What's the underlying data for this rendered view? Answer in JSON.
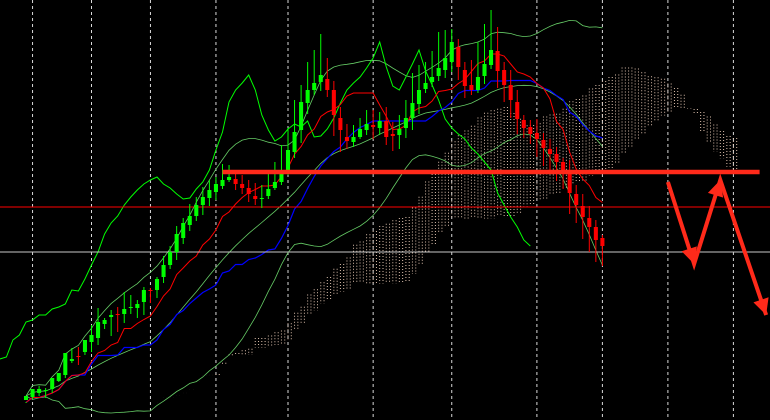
{
  "colors": {
    "background": "#000000",
    "grid": "#ffffff",
    "bull_candle": "#00ff00",
    "bear_candle": "#ff0000",
    "tenkan": "#ff0000",
    "kijun": "#0000ff",
    "chikou": "#00ff00",
    "bollinger": "#66cc66",
    "cloud_dots": "#f5d5c0",
    "hline_upper": "#ff0000",
    "hline_lower": "#c8c8c8",
    "annotation": "#ff2a1a"
  },
  "chart_data": {
    "type": "candlestick",
    "grid": true,
    "ylim": [
      0,
      420
    ],
    "vertical_grid_at_bar": [
      1,
      10,
      19,
      29,
      40,
      53,
      65,
      78,
      88,
      98,
      108,
      117
    ],
    "horizontal_levels": [
      {
        "name": "upper-level",
        "value": 213
      },
      {
        "name": "lower-level",
        "value": 168
      }
    ],
    "annotation": {
      "resistance_line": {
        "from_bar": 30,
        "to_bar": 112,
        "value": 248
      },
      "projected_path": [
        {
          "bar": 98,
          "value": 238
        },
        {
          "bar": 102,
          "value": 156
        },
        {
          "bar": 106,
          "value": 240
        },
        {
          "bar": 113,
          "value": 105
        }
      ]
    },
    "ohlc": [
      [
        20,
        24,
        18,
        17
      ],
      [
        23,
        31,
        28,
        21
      ],
      [
        27,
        31,
        24,
        34
      ],
      [
        29,
        30,
        32,
        22
      ],
      [
        31,
        42,
        37,
        27
      ],
      [
        39,
        47,
        44,
        38
      ],
      [
        45,
        67,
        60,
        42
      ],
      [
        59,
        61,
        72,
        57
      ],
      [
        64,
        63,
        73,
        55
      ],
      [
        68,
        80,
        71,
        65
      ],
      [
        78,
        85,
        95,
        68
      ],
      [
        82,
        98,
        112,
        75
      ],
      [
        96,
        100,
        102,
        91
      ],
      [
        103,
        105,
        110,
        84
      ],
      [
        106,
        105,
        113,
        88
      ],
      [
        106,
        111,
        128,
        97
      ],
      [
        112,
        113,
        125,
        106
      ],
      [
        112,
        116,
        120,
        102
      ],
      [
        118,
        130,
        133,
        105
      ],
      [
        130,
        129,
        132,
        117
      ],
      [
        130,
        141,
        143,
        122
      ],
      [
        143,
        155,
        164,
        137
      ],
      [
        155,
        168,
        174,
        151
      ],
      [
        168,
        186,
        194,
        160
      ],
      [
        182,
        197,
        202,
        176
      ],
      [
        195,
        204,
        216,
        189
      ],
      [
        204,
        215,
        223,
        199
      ],
      [
        215,
        223,
        233,
        205
      ],
      [
        222,
        230,
        240,
        214
      ],
      [
        228,
        236,
        243,
        220
      ],
      [
        234,
        240,
        256,
        231
      ],
      [
        240,
        243,
        255,
        238
      ],
      [
        241,
        236,
        250,
        230
      ],
      [
        236,
        232,
        245,
        226
      ],
      [
        232,
        226,
        240,
        218
      ],
      [
        224,
        221,
        237,
        215
      ],
      [
        221,
        222,
        235,
        212
      ],
      [
        224,
        231,
        248,
        221
      ],
      [
        232,
        238,
        258,
        230
      ],
      [
        238,
        250,
        275,
        235
      ],
      [
        249,
        270,
        292,
        245
      ],
      [
        268,
        288,
        320,
        262
      ],
      [
        290,
        318,
        335,
        277
      ],
      [
        317,
        330,
        358,
        306
      ],
      [
        330,
        337,
        370,
        325
      ],
      [
        338,
        345,
        386,
        329
      ],
      [
        341,
        330,
        362,
        323
      ],
      [
        330,
        305,
        339,
        284
      ],
      [
        302,
        290,
        313,
        268
      ],
      [
        283,
        279,
        296,
        271
      ],
      [
        278,
        283,
        295,
        273
      ],
      [
        283,
        291,
        302,
        281
      ],
      [
        290,
        296,
        310,
        285
      ],
      [
        295,
        293,
        310,
        281
      ],
      [
        292,
        299,
        308,
        285
      ],
      [
        299,
        283,
        313,
        275
      ],
      [
        286,
        284,
        298,
        269
      ],
      [
        285,
        291,
        305,
        271
      ],
      [
        292,
        302,
        320,
        282
      ],
      [
        302,
        317,
        347,
        290
      ],
      [
        316,
        330,
        355,
        306
      ],
      [
        331,
        337,
        358,
        327
      ],
      [
        338,
        343,
        369,
        333
      ],
      [
        344,
        352,
        388,
        339
      ],
      [
        350,
        362,
        390,
        342
      ],
      [
        358,
        378,
        391,
        348
      ],
      [
        373,
        353,
        381,
        340
      ],
      [
        350,
        334,
        358,
        322
      ],
      [
        335,
        330,
        360,
        325
      ],
      [
        330,
        343,
        378,
        327
      ],
      [
        344,
        356,
        396,
        336
      ],
      [
        355,
        370,
        410,
        351
      ],
      [
        369,
        349,
        393,
        332
      ],
      [
        350,
        335,
        358,
        318
      ],
      [
        335,
        320,
        350,
        302
      ],
      [
        318,
        301,
        330,
        286
      ],
      [
        300,
        292,
        305,
        282
      ],
      [
        293,
        286,
        300,
        276
      ],
      [
        287,
        281,
        301,
        263
      ],
      [
        280,
        272,
        287,
        254
      ],
      [
        271,
        266,
        281,
        249
      ],
      [
        266,
        258,
        273,
        239
      ],
      [
        258,
        250,
        262,
        231
      ],
      [
        249,
        227,
        260,
        206
      ],
      [
        226,
        215,
        235,
        197
      ],
      [
        214,
        203,
        226,
        181
      ],
      [
        202,
        193,
        214,
        168
      ],
      [
        193,
        180,
        200,
        158
      ],
      [
        182,
        174,
        185,
        154
      ]
    ]
  }
}
